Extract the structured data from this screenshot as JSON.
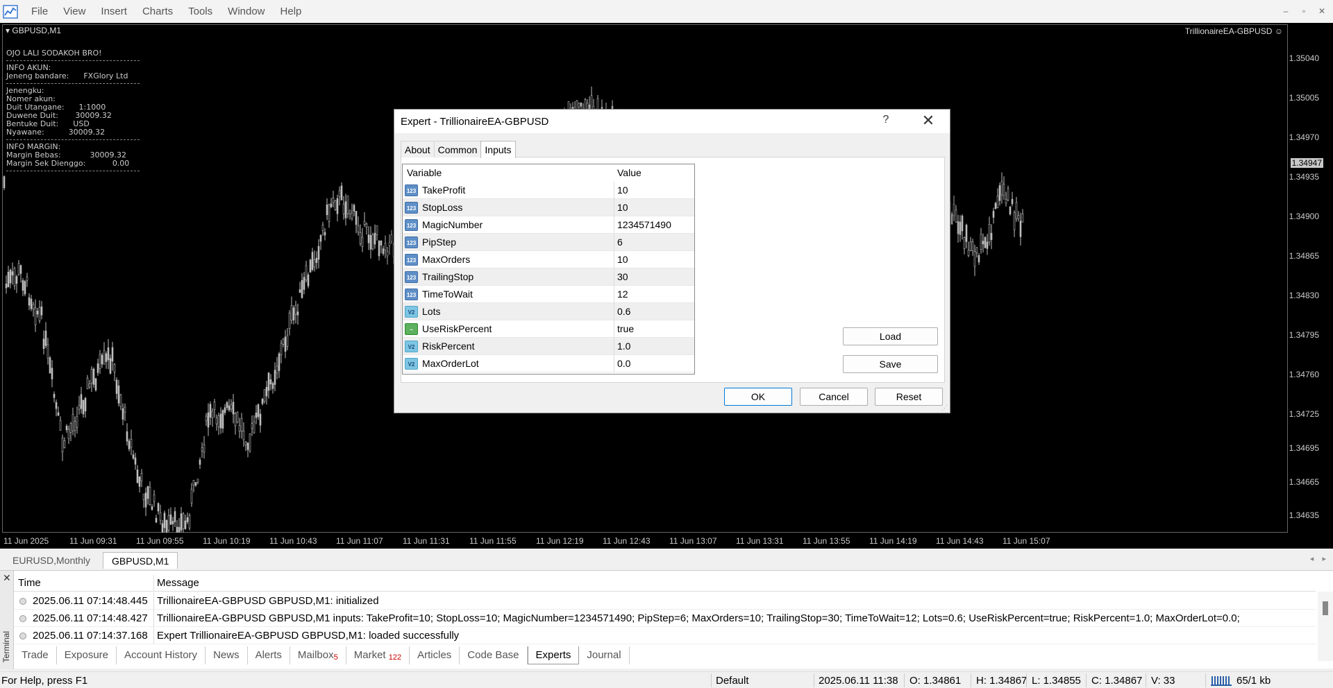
{
  "menu": [
    "File",
    "View",
    "Insert",
    "Charts",
    "Tools",
    "Window",
    "Help"
  ],
  "window_controls": [
    "–",
    "▫",
    "✕"
  ],
  "chart": {
    "symbol": "GBPUSD,M1",
    "ea_label": "TrillionaireEA-GBPUSD",
    "current_price": "1.34947",
    "price_axis": [
      "1.35040",
      "1.35005",
      "1.34970",
      "1.34935",
      "1.34900",
      "1.34865",
      "1.34830",
      "1.34795",
      "1.34760",
      "1.34725",
      "1.34695",
      "1.34665",
      "1.34635"
    ],
    "time_axis": [
      "11 Jun 2025",
      "11 Jun 09:31",
      "11 Jun 09:55",
      "11 Jun 10:19",
      "11 Jun 10:43",
      "11 Jun 11:07",
      "11 Jun 11:31",
      "11 Jun 11:55",
      "11 Jun 12:19",
      "11 Jun 12:43",
      "11 Jun 13:07",
      "11 Jun 13:31",
      "11 Jun 13:55",
      "11 Jun 14:19",
      "11 Jun 14:43",
      "11 Jun 15:07"
    ]
  },
  "info_panel": {
    "slogan": "OJO LALI SODAKOH BRO!",
    "akun_title": "INFO AKUN:",
    "bandar": "Jeneng bandare:      FXGlory Ltd",
    "jenengku": "Jenengku:",
    "nomer": "Nomer akun:",
    "utangan": "Duit Utangane:      1:1000",
    "duwene": "Duwene Duit:       30009.32",
    "bentuke": "Bentuke Duit:      USD",
    "nyawane": "Nyawane:          30009.32",
    "margin_title": "INFO MARGIN:",
    "margin_bebas": "Margin Bebas:            30009.32",
    "margin_dienggo": "Margin Sek Dienggo:           0.00"
  },
  "chart_tabs": [
    "EURUSD,Monthly",
    "GBPUSD,M1"
  ],
  "terminal": {
    "label": "Terminal",
    "col_time": "Time",
    "col_message": "Message",
    "logs": [
      {
        "time": "2025.06.11 07:14:48.445",
        "message": "TrillionaireEA-GBPUSD GBPUSD,M1: initialized"
      },
      {
        "time": "2025.06.11 07:14:48.427",
        "message": "TrillionaireEA-GBPUSD GBPUSD,M1 inputs: TakeProfit=10; StopLoss=10; MagicNumber=1234571490; PipStep=6; MaxOrders=10; TrailingStop=30; TimeToWait=12; Lots=0.6; UseRiskPercent=true; RiskPercent=1.0; MaxOrderLot=0.0;"
      },
      {
        "time": "2025.06.11 07:14:37.168",
        "message": "Expert TrillionaireEA-GBPUSD GBPUSD,M1: loaded successfully"
      }
    ],
    "tabs": [
      {
        "label": "Trade",
        "badge": ""
      },
      {
        "label": "Exposure",
        "badge": ""
      },
      {
        "label": "Account History",
        "badge": ""
      },
      {
        "label": "News",
        "badge": ""
      },
      {
        "label": "Alerts",
        "badge": ""
      },
      {
        "label": "Mailbox",
        "badge": "5"
      },
      {
        "label": "Market",
        "badge": "122"
      },
      {
        "label": "Articles",
        "badge": ""
      },
      {
        "label": "Code Base",
        "badge": ""
      },
      {
        "label": "Experts",
        "badge": ""
      },
      {
        "label": "Journal",
        "badge": ""
      }
    ],
    "active_tab": "Experts"
  },
  "status": {
    "help": "For Help, press F1",
    "profile": "Default",
    "datetime": "2025.06.11 11:38",
    "open": "O: 1.34861",
    "high": "H: 1.34867",
    "low": "L: 1.34855",
    "close": "C: 1.34867",
    "volume": "V: 33",
    "traffic": "65/1 kb"
  },
  "dialog": {
    "title": "Expert - TrillionaireEA-GBPUSD",
    "help": "?",
    "close": "✕",
    "tabs": [
      "About",
      "Common",
      "Inputs"
    ],
    "active_tab": "Inputs",
    "col_variable": "Variable",
    "col_value": "Value",
    "inputs": [
      {
        "type": "int",
        "icon": "123",
        "name": "TakeProfit",
        "value": "10"
      },
      {
        "type": "int",
        "icon": "123",
        "name": "StopLoss",
        "value": "10"
      },
      {
        "type": "int",
        "icon": "123",
        "name": "MagicNumber",
        "value": "1234571490"
      },
      {
        "type": "int",
        "icon": "123",
        "name": "PipStep",
        "value": "6"
      },
      {
        "type": "int",
        "icon": "123",
        "name": "MaxOrders",
        "value": "10"
      },
      {
        "type": "int",
        "icon": "123",
        "name": "TrailingStop",
        "value": "30"
      },
      {
        "type": "int",
        "icon": "123",
        "name": "TimeToWait",
        "value": "12"
      },
      {
        "type": "dbl",
        "icon": "V2",
        "name": "Lots",
        "value": "0.6"
      },
      {
        "type": "bool",
        "icon": "~",
        "name": "UseRiskPercent",
        "value": "true"
      },
      {
        "type": "dbl",
        "icon": "V2",
        "name": "RiskPercent",
        "value": "1.0"
      },
      {
        "type": "dbl",
        "icon": "V2",
        "name": "MaxOrderLot",
        "value": "0.0"
      }
    ],
    "load_label": "Load",
    "save_label": "Save",
    "ok_label": "OK",
    "cancel_label": "Cancel",
    "reset_label": "Reset"
  }
}
